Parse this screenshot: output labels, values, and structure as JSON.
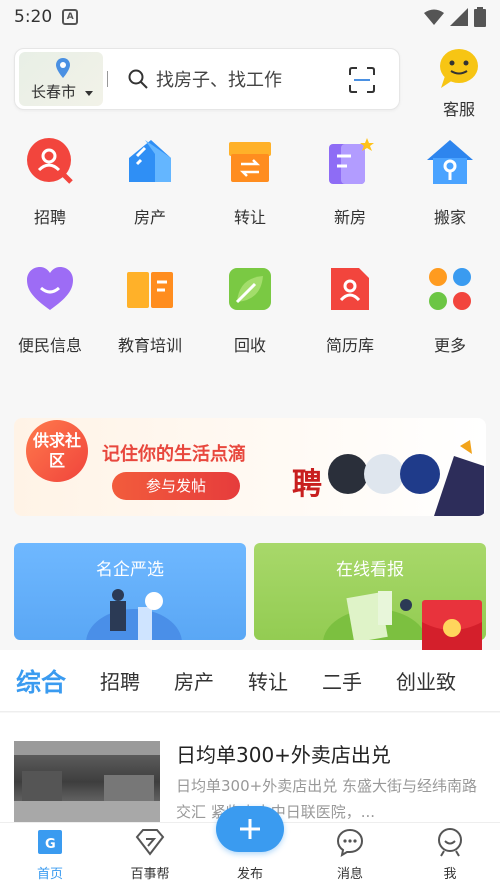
{
  "status": {
    "time": "5:20",
    "notif_icon": "A"
  },
  "search": {
    "city": "长春市",
    "placeholder": "找房子、找工作"
  },
  "service": {
    "label": "客服"
  },
  "grid": [
    {
      "label": "招聘",
      "icon": "recruit-icon"
    },
    {
      "label": "房产",
      "icon": "house-icon"
    },
    {
      "label": "转让",
      "icon": "transfer-icon"
    },
    {
      "label": "新房",
      "icon": "new-house-icon"
    },
    {
      "label": "搬家",
      "icon": "moving-icon"
    },
    {
      "label": "便民信息",
      "icon": "heart-icon"
    },
    {
      "label": "教育培训",
      "icon": "book-icon"
    },
    {
      "label": "回收",
      "icon": "leaf-icon"
    },
    {
      "label": "简历库",
      "icon": "resume-icon"
    },
    {
      "label": "更多",
      "icon": "more-dots-icon"
    }
  ],
  "banner": {
    "badge": "供求社区",
    "title": "记住你的生活点滴",
    "button": "参与发帖",
    "poster_char": "聘"
  },
  "cards": {
    "left": "名企严选",
    "right": "在线看报"
  },
  "tabs": [
    "综合",
    "招聘",
    "房产",
    "转让",
    "二手",
    "创业致"
  ],
  "feed": {
    "title": "日均单300+外卖店出兑",
    "desc": "日均单300+外卖店出兑 东盛大街与经纬南路交汇       紧临吉大中日联医院，..."
  },
  "nav": [
    {
      "label": "首页",
      "active": true
    },
    {
      "label": "百事帮"
    },
    {
      "label": "发布"
    },
    {
      "label": "消息"
    },
    {
      "label": "我"
    }
  ],
  "colors": {
    "accent": "#3a9bf0",
    "red": "#e8473d"
  }
}
